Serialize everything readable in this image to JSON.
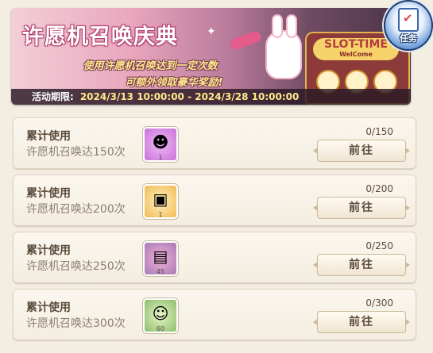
{
  "banner": {
    "title": "许愿机召唤庆典",
    "subtitle_line1": "使用许愿机召唤达到一定次数",
    "subtitle_line2": "可额外领取豪华奖励!",
    "period_label": "活动期限:",
    "period_dates": "2024/3/13 10:00:00 - 2024/3/28 10:00:00",
    "slot_sign": "SLOT-TIME",
    "slot_sign_sub": "WelCome"
  },
  "task_badge": {
    "label": "任务",
    "icon": "clipboard-check-icon"
  },
  "tasks": [
    {
      "title": "累计使用",
      "desc": "许愿机召唤达150次",
      "progress": "0/150",
      "button": "前往",
      "reward_icon": "purple-mask-icon",
      "reward_qty": "1"
    },
    {
      "title": "累计使用",
      "desc": "许愿机召唤达200次",
      "progress": "0/200",
      "button": "前往",
      "reward_icon": "treasure-chest-icon",
      "reward_qty": "1"
    },
    {
      "title": "累计使用",
      "desc": "许愿机召唤达250次",
      "progress": "0/250",
      "button": "前往",
      "reward_icon": "dark-chest-icon",
      "reward_qty": "45"
    },
    {
      "title": "累计使用",
      "desc": "许愿机召唤达300次",
      "progress": "0/300",
      "button": "前往",
      "reward_icon": "character-portrait-icon",
      "reward_qty": "60"
    }
  ],
  "colors": {
    "banner_accent": "#e45b8c",
    "subtitle": "#ffe98a",
    "text_dark": "#5a4a3b",
    "text_muted": "#8b7e70"
  }
}
